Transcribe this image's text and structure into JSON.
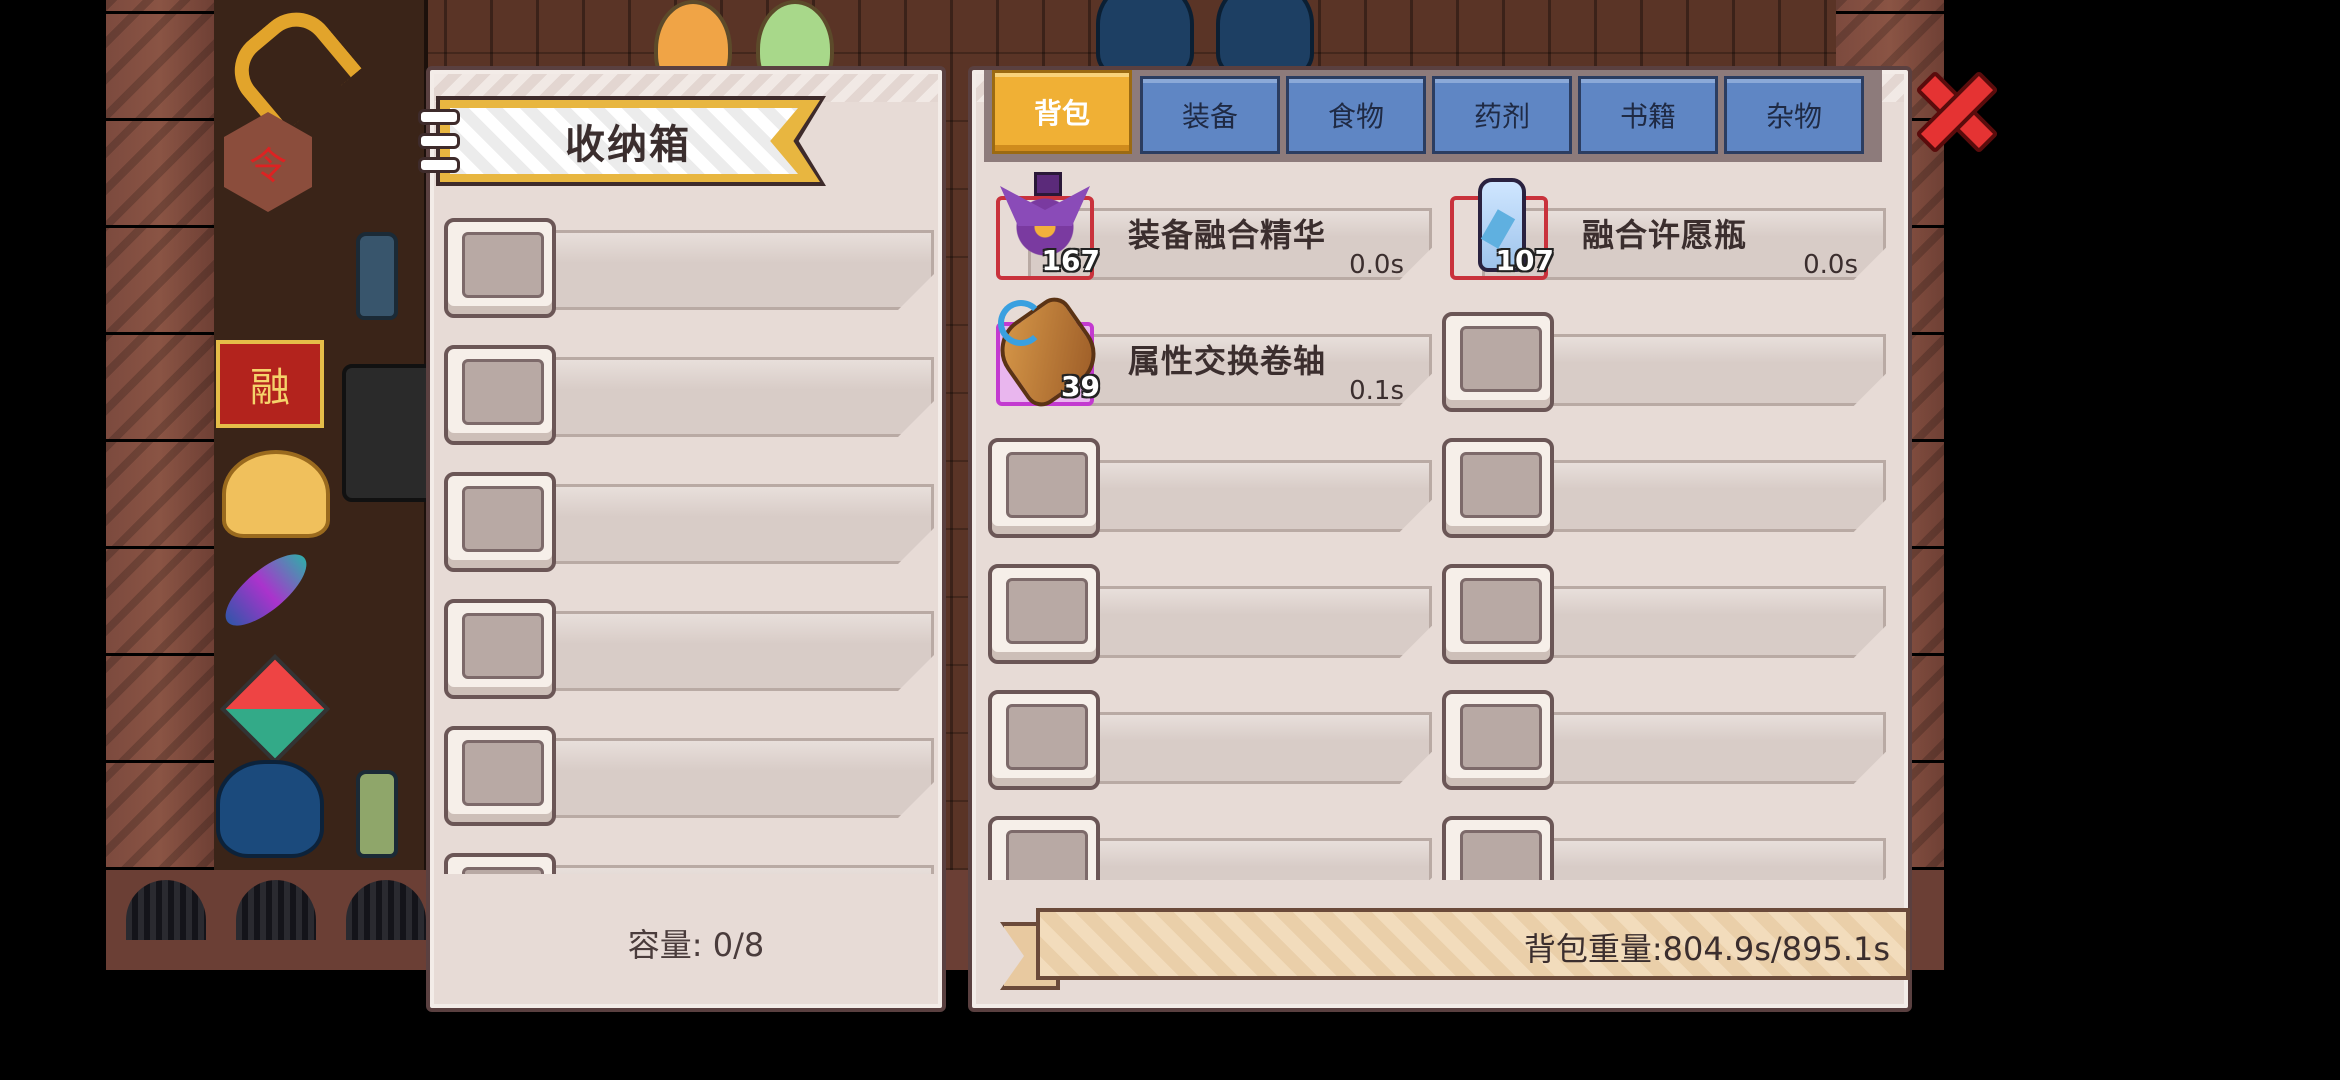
{
  "storage": {
    "title": "收纳箱",
    "slots": [
      "",
      "",
      "",
      "",
      "",
      ""
    ],
    "capacity": "容量: 0/8"
  },
  "bag": {
    "tabs": [
      {
        "label": "背包",
        "active": true
      },
      {
        "label": "装备",
        "active": false
      },
      {
        "label": "食物",
        "active": false
      },
      {
        "label": "药剂",
        "active": false
      },
      {
        "label": "书籍",
        "active": false
      },
      {
        "label": "杂物",
        "active": false
      }
    ],
    "items": [
      {
        "name": "装备融合精华",
        "count": "167",
        "weight": "0.0s",
        "icon": "essence-potion-icon",
        "frame_color": "#c9323c"
      },
      {
        "name": "融合许愿瓶",
        "count": "107",
        "weight": "0.0s",
        "icon": "wish-bottle-icon",
        "frame_color": "#c9323c"
      },
      {
        "name": "属性交换卷轴",
        "count": "39",
        "weight": "0.1s",
        "icon": "attribute-scroll-icon",
        "frame_color": "#c33ad0"
      }
    ],
    "empty_slots": 9,
    "weight_text": "背包重量:804.9s/895.1s"
  },
  "colors": {
    "active_tab": "#f0b035",
    "inactive_tab": "#5f86c4",
    "close": "#e53333",
    "panel": "#e7dbd6"
  }
}
